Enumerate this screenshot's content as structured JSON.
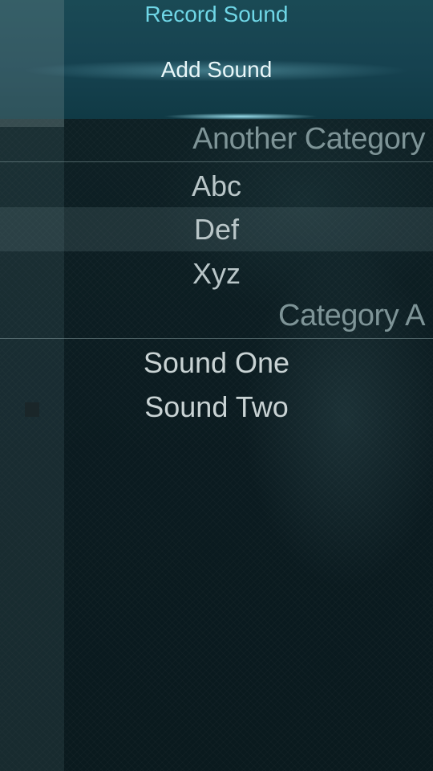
{
  "pulley_menu": {
    "record_sound_label": "Record Sound",
    "add_sound_label": "Add Sound"
  },
  "sections": [
    {
      "header": "Another Category",
      "items": [
        {
          "label": "Abc"
        },
        {
          "label": "Def",
          "highlighted": true
        },
        {
          "label": "Xyz"
        }
      ]
    },
    {
      "header": "Category A",
      "items": [
        {
          "label": "Sound One"
        },
        {
          "label": "Sound Two",
          "indicator": "square-stop-icon"
        }
      ]
    }
  ],
  "colors": {
    "accent": "#6fd6e6",
    "pulley_background": "#164250",
    "background": "#0c1c21",
    "section_header": "#7e9497",
    "item_text": "#b9c6c8"
  }
}
